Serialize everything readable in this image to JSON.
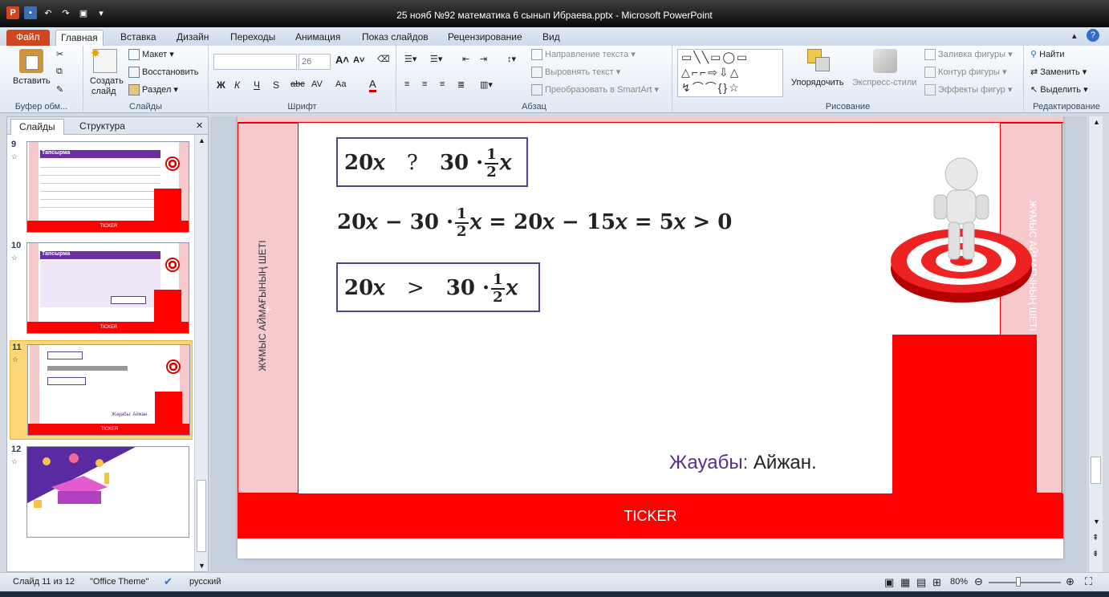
{
  "window": {
    "title": "25 нояб №92 математика 6 сынып Ибраева.pptx  -  Microsoft PowerPoint"
  },
  "tabs": [
    "Файл",
    "Главная",
    "Вставка",
    "Дизайн",
    "Переходы",
    "Анимация",
    "Показ слайдов",
    "Рецензирование",
    "Вид"
  ],
  "ribbon": {
    "clipboard": {
      "label": "Буфер обм...",
      "paste": "Вставить"
    },
    "slides": {
      "label": "Слайды",
      "new_slide": "Создать",
      "new_slide2": "слайд",
      "layout": "Макет",
      "reset": "Восстановить",
      "section": "Раздел"
    },
    "font": {
      "label": "Шрифт",
      "size": "26",
      "bold": "Ж",
      "italic": "К",
      "underline": "Ч",
      "strike": "S",
      "abc": "abc",
      "spacing": "AV",
      "case": "Aa",
      "color": "A"
    },
    "paragraph": {
      "label": "Абзац",
      "text_direction": "Направление текста",
      "align_text": "Выровнять текст",
      "smartart": "Преобразовать в SmartArt"
    },
    "drawing": {
      "label": "Рисование",
      "arrange": "Упорядочить",
      "quick_styles": "Экспресс-стили",
      "fill": "Заливка фигуры",
      "outline": "Контур фигуры",
      "effects": "Эффекты фигур"
    },
    "editing": {
      "label": "Редактирование",
      "find": "Найти",
      "replace": "Заменить",
      "select": "Выделить"
    }
  },
  "panel": {
    "tab_slides": "Слайды",
    "tab_outline": "Структура",
    "close": "×"
  },
  "thumbs": [
    {
      "num": "9",
      "title": "Тапсырма",
      "ticker": "TICKER"
    },
    {
      "num": "10",
      "title": "Тапсырма",
      "ticker": "TICKER"
    },
    {
      "num": "11",
      "ticker": "TICKER",
      "answer": "Жауабы:  Айжан."
    },
    {
      "num": "12"
    }
  ],
  "slide": {
    "side_label": "ЖҰМЫС АЙМАҒЫНЫҢ ШЕТІ",
    "side_label_right": "ЖҰМЫС АЙМАҒЫНЫҢ ШЕТІ",
    "plus": "+",
    "eq1_left": "20𝑥",
    "eq1_op": "?",
    "eq1_right": "30 ·",
    "eq2_a": "20𝑥 − 30 ·",
    "eq2_b": "𝑥 =  20𝑥 − 15𝑥 = 5𝑥 > 0",
    "eq3_left": "20𝑥",
    "eq3_op": ">",
    "eq3_right": "30 ·",
    "frac_num": "1",
    "frac_den": "2",
    "var_x": "𝑥",
    "answer_label": "Жауабы:",
    "answer_value": " Айжан.",
    "ticker": "TICKER",
    "accent": "#ff0000",
    "answer_color": "#5a2d91"
  },
  "status": {
    "slide_info": "Слайд 11 из 12",
    "theme": "\"Office Theme\"",
    "language": "русский",
    "zoom": "80%"
  }
}
